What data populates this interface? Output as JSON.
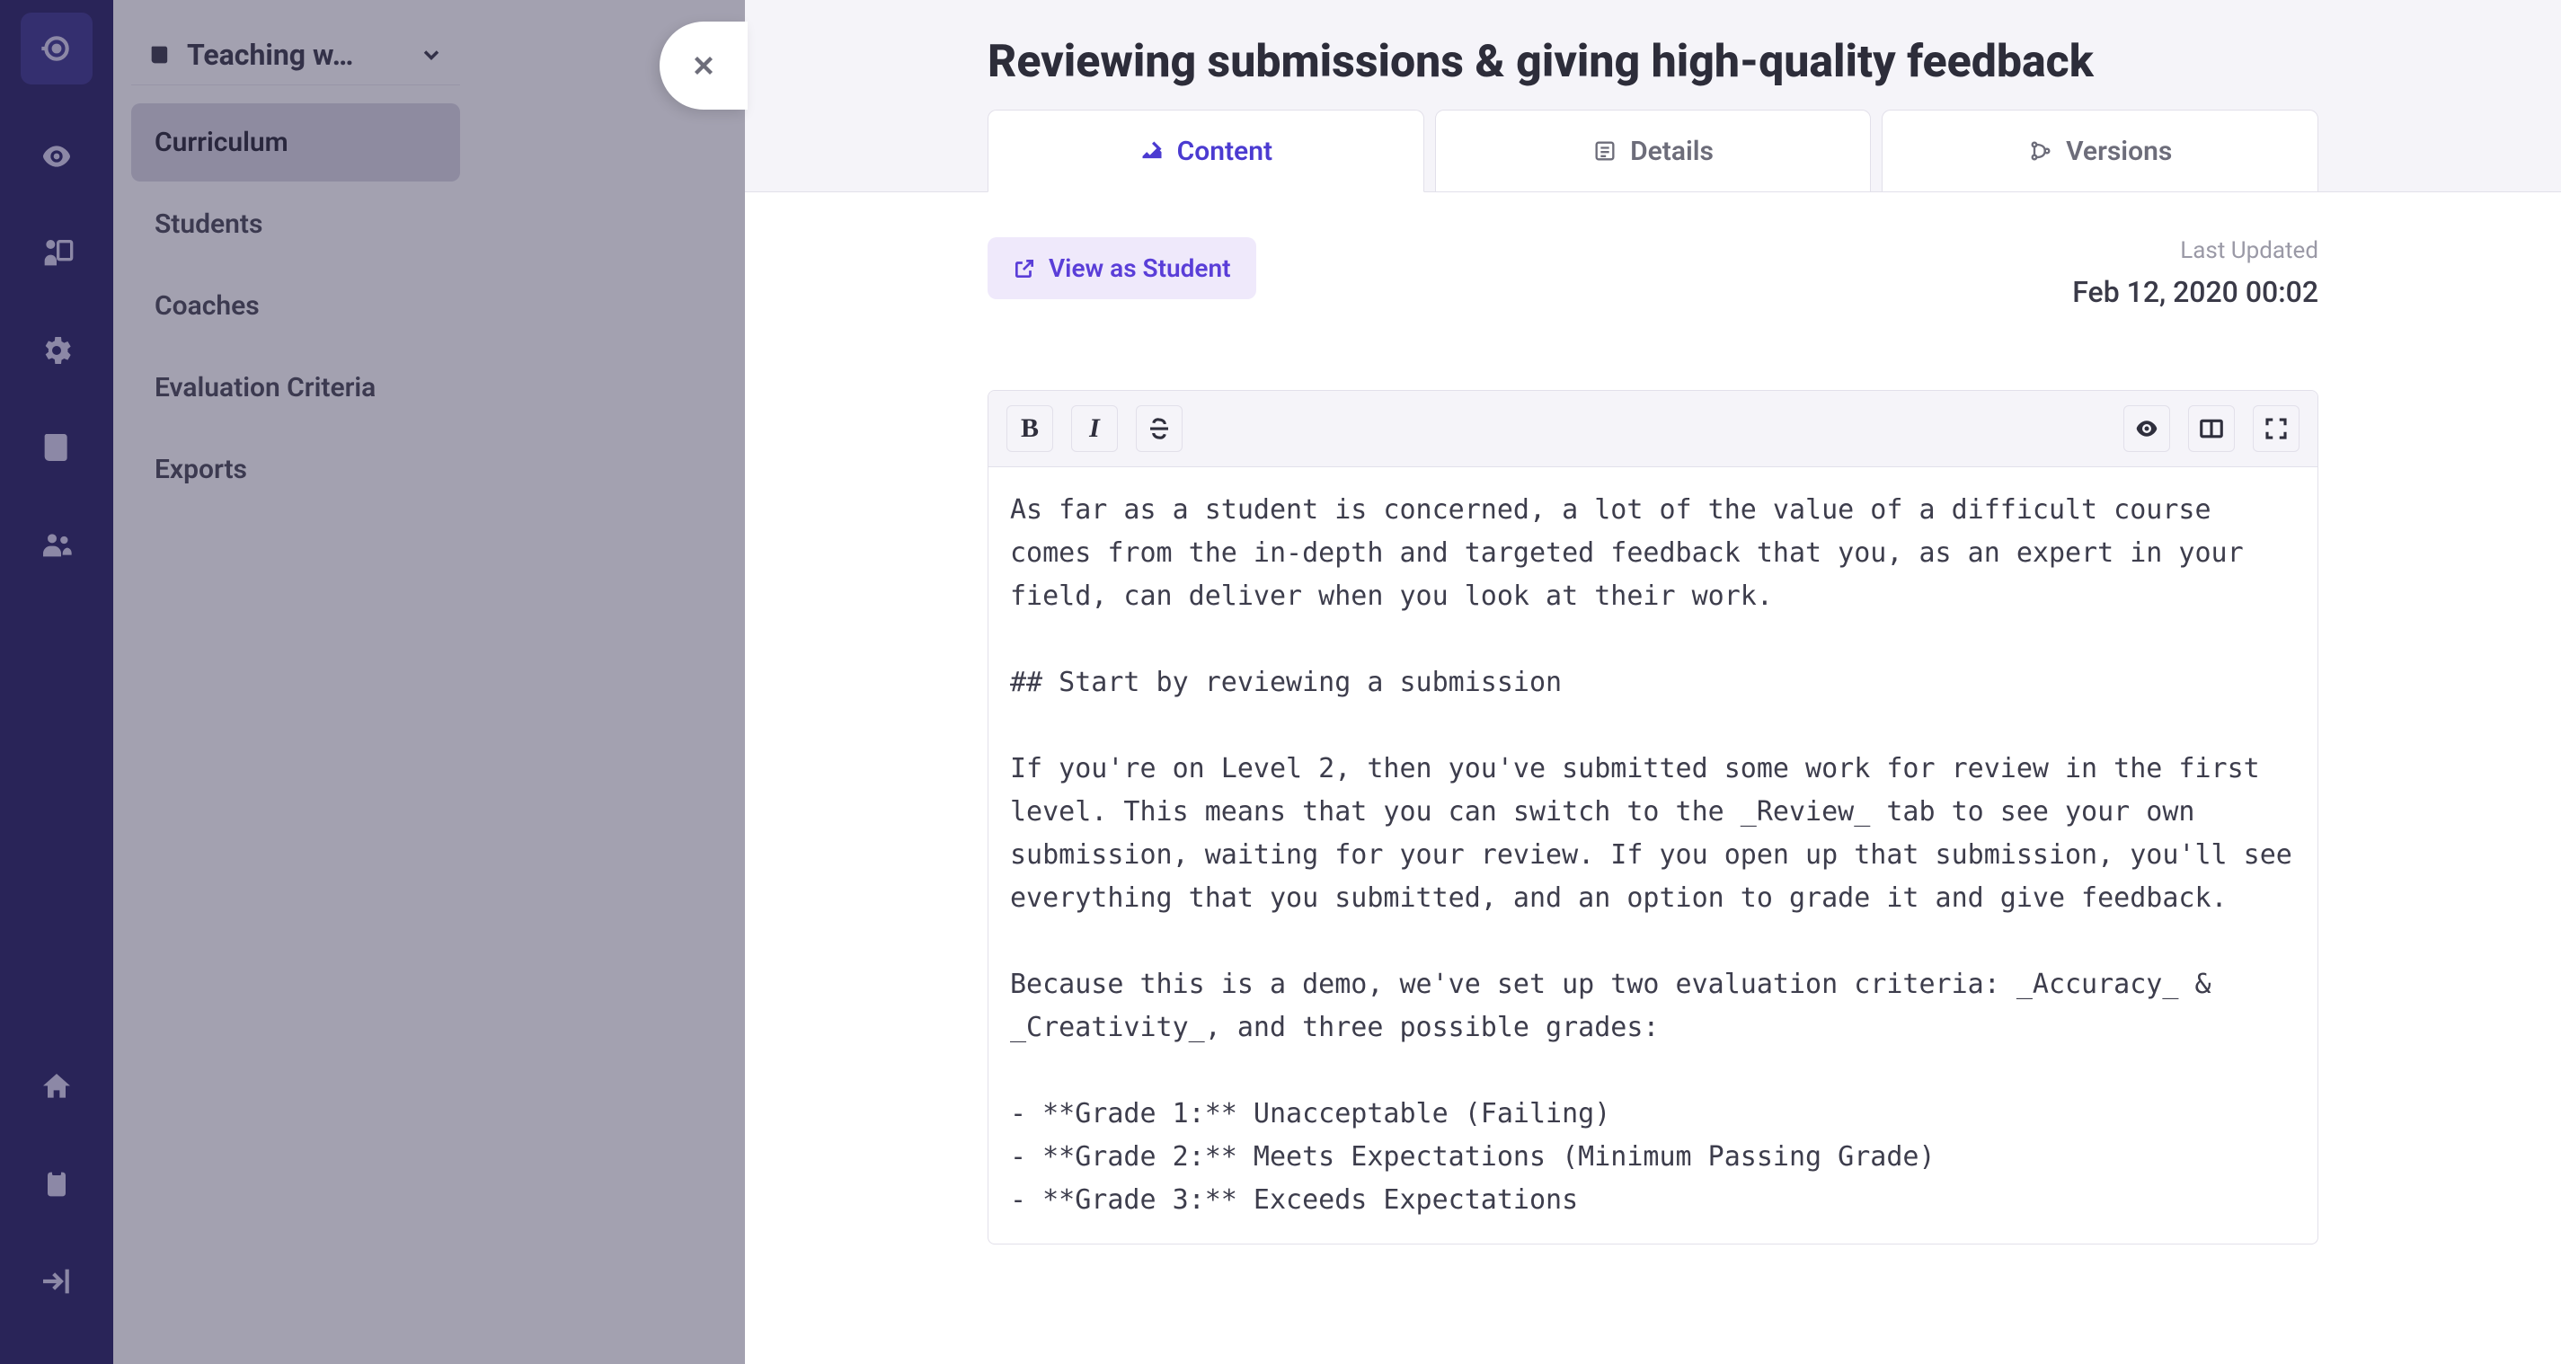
{
  "rail": {
    "items_top": [
      "logo",
      "overview",
      "teach",
      "settings",
      "book",
      "community"
    ],
    "items_bottom": [
      "home",
      "clipboard",
      "logout"
    ]
  },
  "course": {
    "selector_label": "Teaching w…",
    "nav": [
      {
        "label": "Curriculum",
        "active": true
      },
      {
        "label": "Students",
        "active": false
      },
      {
        "label": "Coaches",
        "active": false
      },
      {
        "label": "Evaluation Criteria",
        "active": false
      },
      {
        "label": "Exports",
        "active": false
      }
    ]
  },
  "editor": {
    "title": "Reviewing submissions & giving high-quality feedback",
    "tabs": [
      {
        "key": "content",
        "label": "Content",
        "active": true
      },
      {
        "key": "details",
        "label": "Details",
        "active": false
      },
      {
        "key": "versions",
        "label": "Versions",
        "active": false
      }
    ],
    "view_as_student": "View as Student",
    "last_updated_label": "Last Updated",
    "last_updated_value": "Feb 12, 2020 00:02",
    "markdown": "As far as a student is concerned, a lot of the value of a difficult course comes from the in-depth and targeted feedback that you, as an expert in your field, can deliver when you look at their work.\n\n## Start by reviewing a submission\n\nIf you're on Level 2, then you've submitted some work for review in the first level. This means that you can switch to the _Review_ tab to see your own submission, waiting for your review. If you open up that submission, you'll see everything that you submitted, and an option to grade it and give feedback.\n\nBecause this is a demo, we've set up two evaluation criteria: _Accuracy_ & _Creativity_, and three possible grades:\n\n- **Grade 1:** Unacceptable (Failing)\n- **Grade 2:** Meets Expectations (Minimum Passing Grade)\n- **Grade 3:** Exceeds Expectations"
  }
}
